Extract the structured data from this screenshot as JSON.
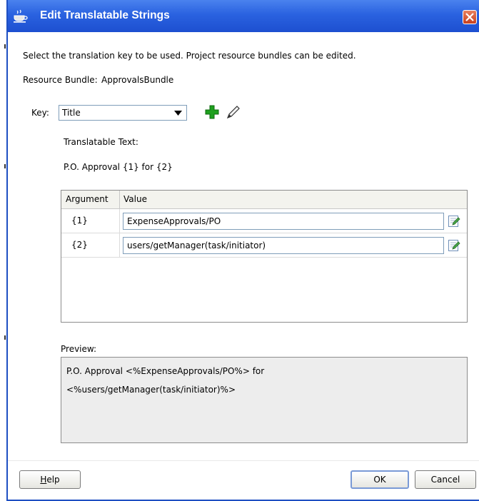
{
  "dialog": {
    "title": "Edit Translatable Strings",
    "instruction": "Select the translation key to be used. Project resource bundles can be edited.",
    "resource_bundle_label": "Resource Bundle:",
    "resource_bundle_value": "ApprovalsBundle"
  },
  "key": {
    "label": "Key:",
    "selected": "Title",
    "add_icon": "plus-icon",
    "edit_icon": "pencil-icon"
  },
  "translatable": {
    "label": "Translatable Text:",
    "text": "P.O. Approval {1} for {2}"
  },
  "table": {
    "columns": [
      "Argument",
      "Value"
    ],
    "rows": [
      {
        "argument": "{1}",
        "value": "ExpenseApprovals/PO"
      },
      {
        "argument": "{2}",
        "value": "users/getManager(task/initiator)"
      }
    ]
  },
  "preview": {
    "label": "Preview:",
    "line1": "P.O. Approval <%ExpenseApprovals/PO%> for",
    "line2": "<%users/getManager(task/initiator)%>"
  },
  "buttons": {
    "help_first": "H",
    "help_rest": "elp",
    "ok": "OK",
    "cancel": "Cancel"
  },
  "colors": {
    "titlebar": "#2a62e0",
    "close": "#d8502e",
    "add_icon": "#1ea01e"
  }
}
